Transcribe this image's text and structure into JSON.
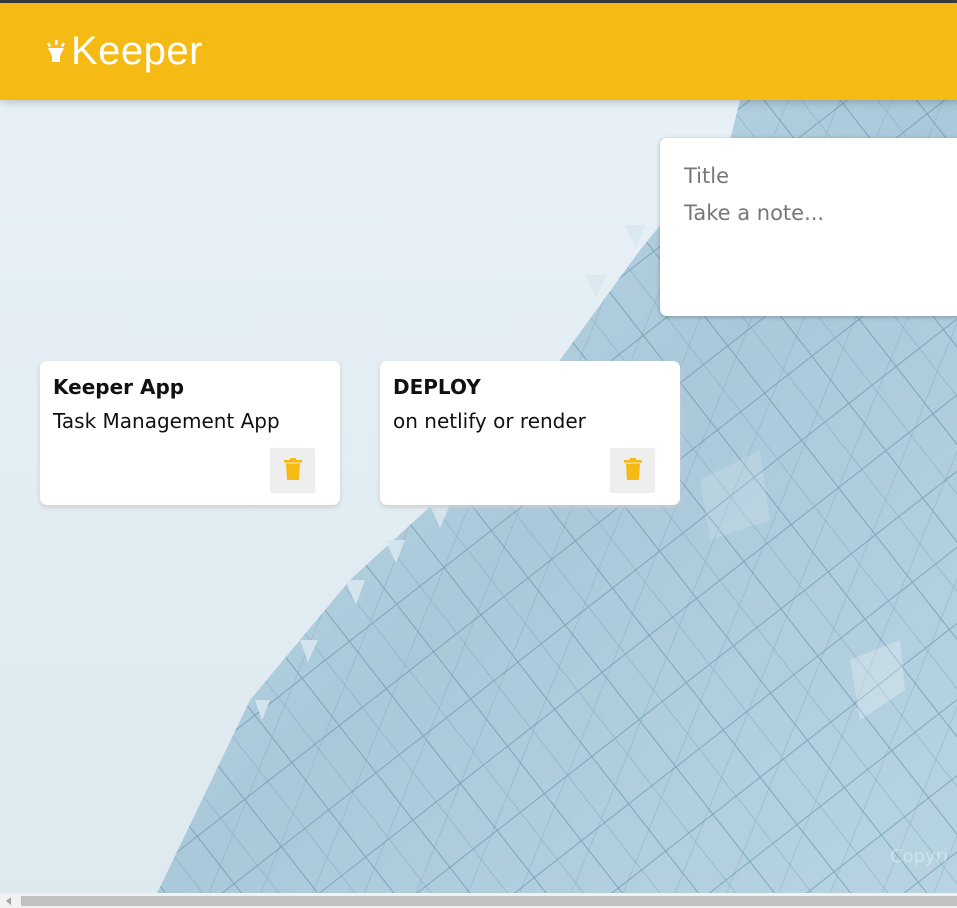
{
  "header": {
    "logo_text": "Keeper",
    "logo_icon": "lightbulb-icon",
    "background_color": "#f5ba13"
  },
  "create_note": {
    "title_placeholder": "Title",
    "content_placeholder": "Take a note..."
  },
  "notes": [
    {
      "title": "Keeper App",
      "content": "Task Management App",
      "delete_icon": "trash-icon"
    },
    {
      "title": "DEPLOY",
      "content": "on netlify or render",
      "delete_icon": "trash-icon"
    }
  ],
  "footer": {
    "text": "Copyri"
  },
  "colors": {
    "accent": "#f5ba13",
    "card": "#ffffff",
    "delete_bg": "#eeeeee"
  }
}
